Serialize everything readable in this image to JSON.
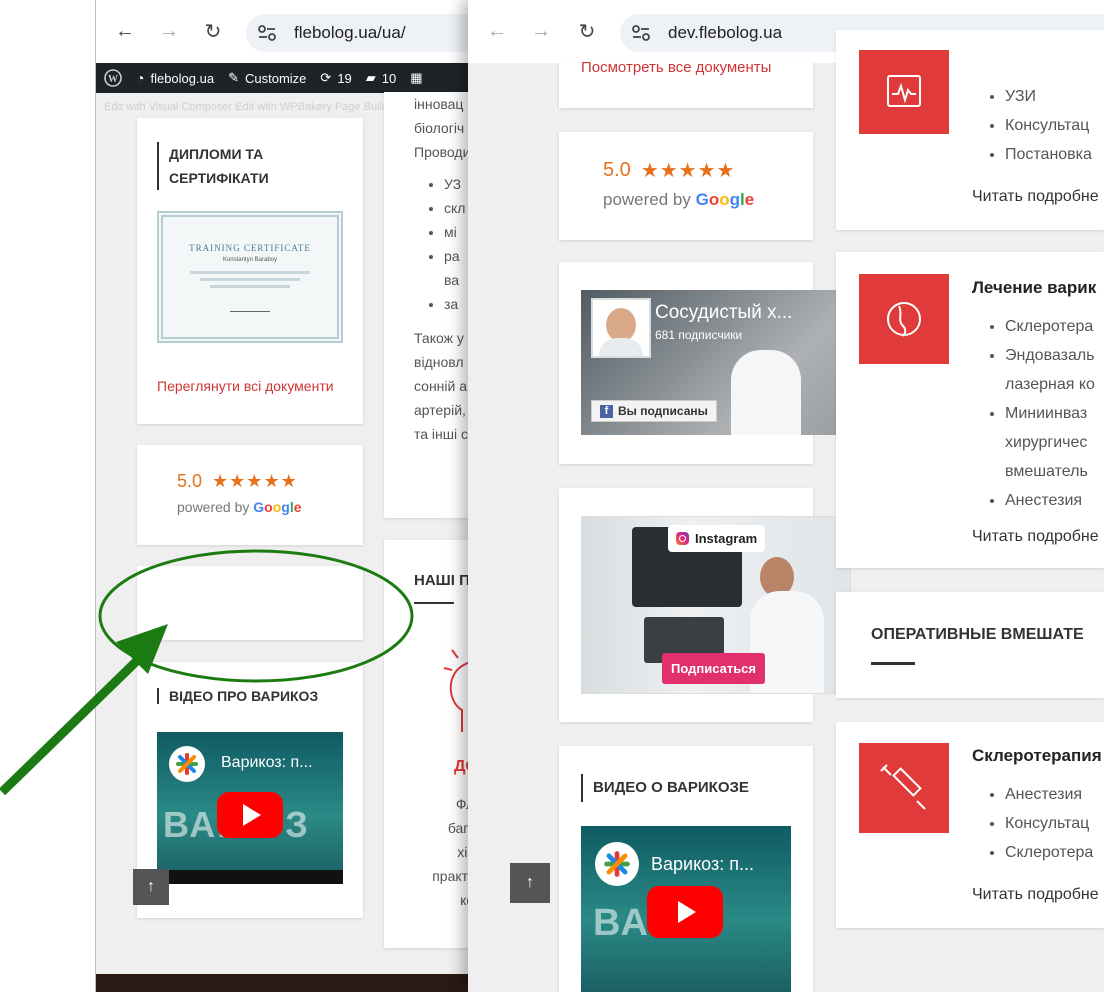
{
  "left_window": {
    "url": "flebolog.ua/ua/",
    "admin_bar": {
      "site": "flebolog.ua",
      "customize": "Customize",
      "updates": "19",
      "comments": "10"
    },
    "admin_sub": "Edit with Visual Composer   Edit with WPBakery Page Builder",
    "diplomas_title": "ДИПЛОМИ ТА СЕРТИФІКАТИ",
    "certificate": {
      "title": "TRAINING CERTIFICATE",
      "name": "Konstantyn Baraboy"
    },
    "view_docs_link": "Переглянути всі документи",
    "rating_value": "5.0",
    "powered_by": "powered by",
    "google": [
      "G",
      "o",
      "o",
      "g",
      "l",
      "e"
    ],
    "video_title": "ВІДЕО ПРО ВАРИКОЗ",
    "video_caption": "Варикоз: п...",
    "video_big_text": "ВАР   ОЗ",
    "our_heading": "НАШІ П",
    "col_text_top": [
      "інновац",
      "біологіч"
    ],
    "col_provodi": "Проводи",
    "col_bullets": [
      "УЗ",
      "скл",
      "мі",
      "ра",
      "ва",
      "за"
    ],
    "col_text_mid": [
      "Також у",
      "відновл",
      "сонній а",
      "артерій,",
      "та інші с"
    ],
    "col_red_word": "ДО",
    "col_text_bottom": [
      "Фле",
      "багат",
      "хіру",
      "практик",
      "кор"
    ]
  },
  "right_window": {
    "url": "dev.flebolog.ua",
    "view_docs_link": "Посмотреть все документы",
    "rating_value": "5.0",
    "powered_by": "powered by",
    "google": [
      "G",
      "o",
      "o",
      "g",
      "l",
      "e"
    ],
    "facebook": {
      "page_name": "Сосудистый х...",
      "followers": "681 подписчики",
      "button": "Вы подписаны"
    },
    "instagram": {
      "label": "Instagram",
      "button": "Подписаться"
    },
    "video_title": "ВИДЕО О ВАРИКОЗЕ",
    "video_caption": "Варикоз: п...",
    "video_big_text": "ВА    З",
    "services": [
      {
        "title": "",
        "items": [
          "УЗИ",
          "Консультац",
          "Постановка"
        ],
        "read_more": "Читать подробне"
      },
      {
        "title": "Лечение варик",
        "items": [
          "Склеротера",
          "Эндовазаль",
          "лазерная ко",
          "Миниинваз",
          "хирургичес",
          "вмешатель",
          "Анестезия"
        ],
        "read_more": "Читать подробне"
      },
      {
        "title": "Склеротерапия",
        "items": [
          "Анестезия",
          "Консультац",
          "Склеротера"
        ],
        "read_more": "Читать подробне"
      }
    ],
    "operative_heading": "ОПЕРАТИВНЫЕ ВМЕШАТЕ"
  },
  "colors": {
    "accent_red": "#e03a3a",
    "link_red": "#cf3535",
    "annotation_green": "#1c7a12",
    "star_orange": "#e7711b"
  }
}
